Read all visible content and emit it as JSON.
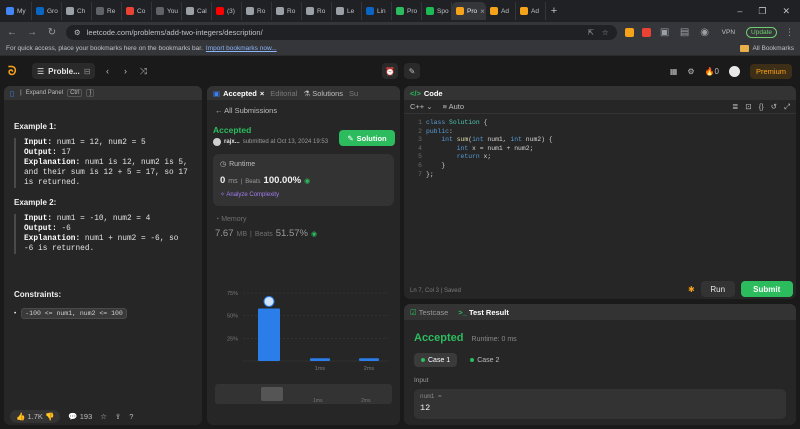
{
  "browser": {
    "tabs": [
      {
        "label": "My",
        "color": "#4285f4"
      },
      {
        "label": "Gro",
        "color": "#0a66c2"
      },
      {
        "label": "Ch",
        "color": "#9aa0a6"
      },
      {
        "label": "Re",
        "color": "#5f6368"
      },
      {
        "label": "Co",
        "color": "#ea4335"
      },
      {
        "label": "You",
        "color": "#5f6368"
      },
      {
        "label": "Cal",
        "color": "#9aa0a6"
      },
      {
        "label": "(3)",
        "color": "#ff0000"
      },
      {
        "label": "Ro",
        "color": "#9aa0a6"
      },
      {
        "label": "Ro",
        "color": "#9aa0a6"
      },
      {
        "label": "Ro",
        "color": "#9aa0a6"
      },
      {
        "label": "Le",
        "color": "#9aa0a6"
      },
      {
        "label": "Lin",
        "color": "#0a66c2"
      },
      {
        "label": "Pro",
        "color": "#2cbb5d"
      },
      {
        "label": "Spo",
        "color": "#1db954"
      },
      {
        "label": "Pro",
        "color": "#f7a21b"
      }
    ],
    "active_tab_close": "×",
    "after_tabs": [
      {
        "label": "Ad",
        "color": "#f7a21b"
      },
      {
        "label": "Ad",
        "color": "#f7a21b"
      }
    ],
    "new_tab": "+",
    "url": "leetcode.com/problems/add-two-integers/description/",
    "vpn": "VPN",
    "update_label": "Update",
    "bookmarks_prompt": "For quick access, place your bookmarks here on the bookmarks bar.",
    "import_link": "Import bookmarks now...",
    "all_bookmarks": "All Bookmarks"
  },
  "lc_nav": {
    "problem_list": "Proble...",
    "streak": "0",
    "premium": "Premium"
  },
  "description": {
    "expand_label": "Expand Panel",
    "kbd1": "Ctrl",
    "kbd2": "}",
    "example1": {
      "title": "Example 1:",
      "input_label": "Input:",
      "input": "num1 = 12, num2 = 5",
      "output_label": "Output:",
      "output": "17",
      "explanation_label": "Explanation:",
      "explanation": "num1 is 12, num2 is 5, and their sum is 12 + 5 = 17, so 17 is returned."
    },
    "example2": {
      "title": "Example 2:",
      "input_label": "Input:",
      "input": "num1 = -10, num2 = 4",
      "output_label": "Output:",
      "output": "-6",
      "explanation_label": "Explanation:",
      "explanation": "num1 + num2 = -6, so -6 is returned."
    },
    "constraints_title": "Constraints:",
    "constraint": "-100 <= num1, num2 <= 100",
    "likes": "1.7K",
    "comments": "193"
  },
  "submission": {
    "tab_accepted": "Accepted",
    "tab_editorial": "Editorial",
    "tab_solutions": "Solutions",
    "tab_submissions": "Su",
    "all_submissions": "All Submissions",
    "status": "Accepted",
    "user": "rajx...",
    "submitted": "submitted at Oct 13, 2024 19:53",
    "solution_btn": "Solution",
    "runtime_label": "Runtime",
    "runtime_value": "0",
    "runtime_unit": "ms",
    "beats_label": "Beats",
    "runtime_beats": "100.00%",
    "analyze": "Analyze Complexity",
    "memory_label": "Memory",
    "memory_value": "7.67",
    "memory_unit": "MB",
    "memory_beats": "51.57%"
  },
  "chart_data": {
    "type": "bar",
    "categories": [
      "0ms",
      "1ms",
      "2ms"
    ],
    "values": [
      58,
      3,
      3
    ],
    "yticks": [
      "75%",
      "50%",
      "25%"
    ],
    "ylim": [
      0,
      85
    ],
    "color": "#2b7de9",
    "highlight_category": "0ms"
  },
  "code": {
    "title": "Code",
    "language": "C++",
    "mode": "Auto",
    "lines": [
      "class Solution {",
      "public:",
      "    int sum(int num1, int num2) {",
      "        int x = num1 + num2;",
      "        return x;",
      "    }",
      "};"
    ],
    "status": "Ln 7, Col 3",
    "saved": "Saved",
    "run": "Run",
    "submit": "Submit"
  },
  "test": {
    "tab_testcase": "Testcase",
    "tab_result": "Test Result",
    "result": "Accepted",
    "runtime": "Runtime: 0 ms",
    "case1": "Case 1",
    "case2": "Case 2",
    "input_label": "Input",
    "input_name": "num1 =",
    "input_value": "12"
  }
}
